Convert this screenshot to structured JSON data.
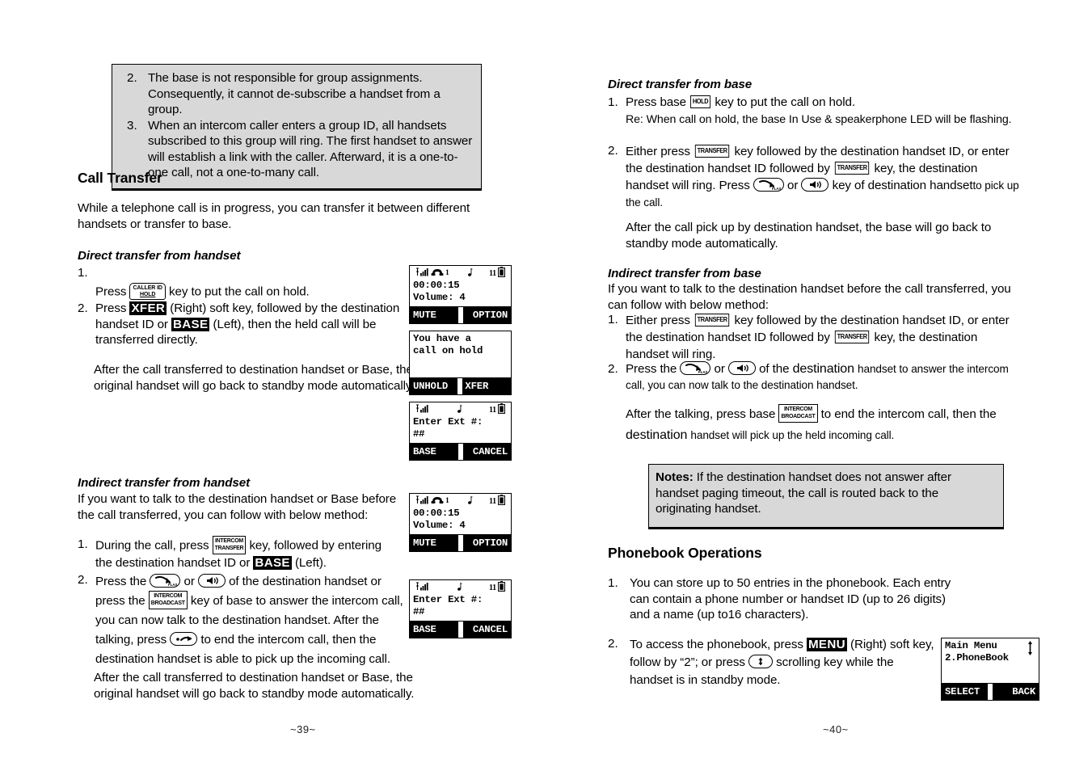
{
  "document": {
    "left_page_number": "~39~",
    "right_page_number": "~40~"
  },
  "left_column": {
    "top_note_box": {
      "items": [
        {
          "num": "2.",
          "text": "The base is not responsible for group assignments. Consequently, it cannot de-subscribe a handset from a group."
        },
        {
          "num": "3.",
          "text": "When an intercom caller enters a group ID, all handsets subscribed to this group will ring.  The first handset to answer will establish a link with the caller.  Afterward, it is a one-to-one call, not a one-to-many call."
        }
      ]
    },
    "section_title": "Call Transfer",
    "intro": "While a telephone call is in progress, you can transfer it between different handsets or transfer to base.",
    "direct_handset": {
      "heading": "Direct transfer from handset",
      "step1_num": "1.",
      "step1_before": "Press",
      "step1_key_line1": "CALLER ID",
      "step1_key_line2": "HOLD",
      "step1_after": "key to put the call on hold.",
      "step2_num": "2.",
      "step2_a": "Press",
      "step2_key1": "XFER",
      "step2_b": "(Right) soft key, followed by the destination handset ID or",
      "step2_key2": "BASE",
      "step2_c": "(Left), then the held call will be transferred directly.",
      "note": "After the call transferred to destination handset or Base, the original handset will go back to standby mode automatically."
    },
    "indirect_handset": {
      "heading": "Indirect transfer from handset",
      "intro": "If you want to talk to the destination handset or Base before the call transferred, you can follow with below method:",
      "step1_num": "1.",
      "step1_a": "During the call, press",
      "step1_key_line1": "INTERCOM",
      "step1_key_line2": "TRANSFER",
      "step1_b": "key, followed by entering the destination handset ID or",
      "step1_key2": "BASE",
      "step1_c": "(Left).",
      "step2_num": "2.",
      "step2_a": "Press the",
      "step2_key_talk": "talk-flash-key-icon",
      "step2_or": "or",
      "step2_key_speaker": "speakerphone-key-icon",
      "step2_b": "of the destination handset or press the",
      "step2_key_line1": "INTERCOM",
      "step2_key_line2": "BROADCAST",
      "step2_c": "key of base to answer the intercom call, you can now talk to the destination handset. After the talking, press",
      "step2_key_end": "end-call-key-icon",
      "step2_d": "to end the intercom call, then the destination handset is able to pick up the incoming call.",
      "note": "After the call transferred to destination handset or Base, the original handset will go back to standby mode automatically."
    },
    "lcd_screens": [
      {
        "name": "in-call-screen",
        "statusbar": {
          "signal": "signal-bars-icon",
          "handset": "handset-icon",
          "handset_id": "1",
          "note": "music-note-icon",
          "extension": "11",
          "battery": "battery-icon"
        },
        "lines": [
          "00:00:15",
          "Volume: 4"
        ],
        "softkey_left": "MUTE",
        "softkey_right": "OPTION"
      },
      {
        "name": "call-on-hold-screen",
        "lines": [
          "You have a",
          "call on hold"
        ],
        "softkey_left": "UNHOLD",
        "softkey_right": "XFER"
      },
      {
        "name": "enter-ext-screen",
        "statusbar": {
          "signal": "signal-bars-icon",
          "note": "music-note-icon",
          "extension": "11",
          "battery": "battery-icon"
        },
        "lines": [
          "Enter Ext #:",
          "##"
        ],
        "softkey_left": "BASE",
        "softkey_right": "CANCEL"
      },
      {
        "name": "in-call-screen-2",
        "statusbar": {
          "signal": "signal-bars-icon",
          "handset": "handset-icon",
          "handset_id": "1",
          "note": "music-note-icon",
          "extension": "11",
          "battery": "battery-icon"
        },
        "lines": [
          "00:00:15",
          "Volume: 4"
        ],
        "softkey_left": "MUTE",
        "softkey_right": "OPTION"
      },
      {
        "name": "enter-ext-screen-2",
        "statusbar": {
          "signal": "signal-bars-icon",
          "note": "music-note-icon",
          "extension": "11",
          "battery": "battery-icon"
        },
        "lines": [
          "Enter Ext #:",
          "##"
        ],
        "softkey_left": "BASE",
        "softkey_right": "CANCEL"
      }
    ]
  },
  "right_column": {
    "direct_base": {
      "heading": "Direct transfer from base",
      "step1_num": "1.",
      "step1_a": "Press base",
      "step1_key": "HOLD",
      "step1_b": "key to put the call on hold.",
      "step1_re": "Re: When call on hold, the base In Use & speakerphone LED will be flashing.",
      "step2_num": "2.",
      "step2_a": "Either press",
      "step2_key1": "TRANSFER",
      "step2_b": "key followed by the destination handset ID, or enter the destination handset ID followed by",
      "step2_key2": "TRANSFER",
      "step2_c": "key, the destination handset will ring. Press",
      "step2_key_talk": "talk-flash-key-icon",
      "step2_or": "or",
      "step2_key_speaker": "speakerphone-key-icon",
      "step2_d": "key of destination handset",
      "step2_e": "to pick up the call.",
      "note": "After the call pick up by destination handset, the base will go back to standby mode automatically."
    },
    "indirect_base": {
      "heading": "Indirect transfer from base",
      "intro": "If you want to talk to the destination handset before the call transferred, you can follow with below method:",
      "step1_num": "1.",
      "step1_a": "Either press",
      "step1_key1": "TRANSFER",
      "step1_b": "key followed by the destination handset ID, or enter the destination handset ID followed by",
      "step1_key2": "TRANSFER",
      "step1_c": "key, the destination handset will ring.",
      "step2_num": "2.",
      "step2_a": "Press the",
      "step2_key_talk": "talk-flash-key-icon",
      "step2_or": "or",
      "step2_key_speaker": "speakerphone-key-icon",
      "step2_b": "of the",
      "step2_b2": "destination",
      "step2_b3": "handset to answer the intercom",
      "step2_c": "call, you can now talk to the destination handset.",
      "note_a": "After the talking, press base",
      "note_key_line1": "INTERCOM",
      "note_key_line2": "BROADCAST",
      "note_b": "to end the intercom call, then the",
      "note_c": "destination",
      "note_d": "handset will pick up the held incoming call."
    },
    "notes_box": {
      "label": "Notes:",
      "text": "If the destination handset does not answer after handset paging timeout, the call is routed back to the originating handset."
    },
    "phonebook": {
      "section_title": "Phonebook Operations",
      "item1_num": "1.",
      "item1_text": "You can store up to 50 entries in the phonebook. Each entry can contain a phone number or handset ID (up to 26 digits) and a name (up to16 characters).",
      "item2_num": "2.",
      "item2_a": "To access the phonebook, press",
      "item2_key": "MENU",
      "item2_b": "(Right) soft key, follow by “2”; or press",
      "item2_key_scroll": "scroll-key-icon",
      "item2_c": "scrolling key while the handset is in standby mode."
    },
    "lcd_main_menu": {
      "name": "main-menu-screen",
      "lines": [
        "Main Menu",
        "2.PhoneBook"
      ],
      "scroll_indicator": "up-down-arrow-icon",
      "softkey_left": "SELECT",
      "softkey_right": "BACK"
    }
  }
}
